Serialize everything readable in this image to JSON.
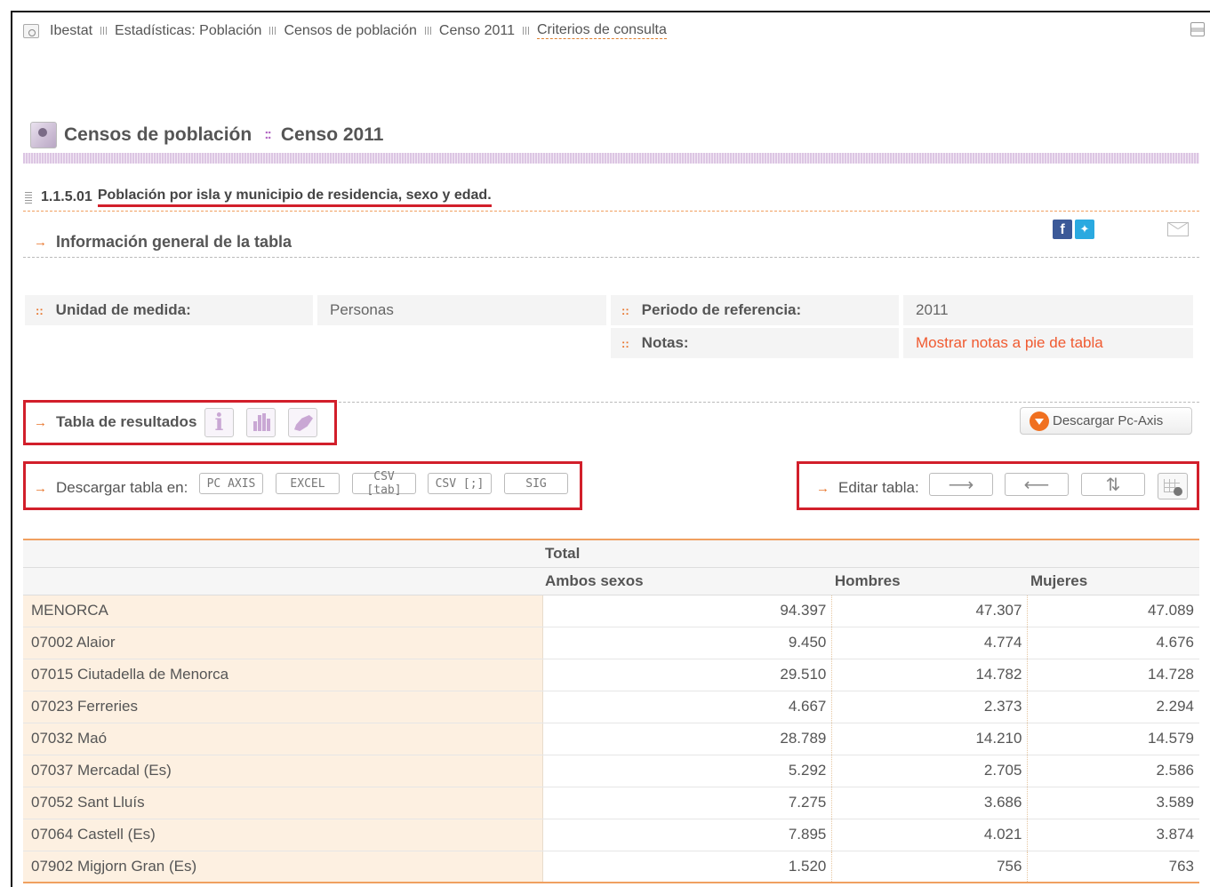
{
  "breadcrumb": {
    "items": [
      "Ibestat",
      "Estadísticas: Población",
      "Censos de población",
      "Censo 2011",
      "Criterios de consulta"
    ]
  },
  "section": {
    "title": "Censos de población",
    "subtitle": "Censo 2011",
    "separator": "::"
  },
  "table_header": {
    "code": "1.1.5.01",
    "name": "Población por isla y municipio de residencia, sexo y edad."
  },
  "info": {
    "heading": "Información general de la tabla",
    "unit_label": "Unidad de medida:",
    "unit_value": "Personas",
    "period_label": "Periodo de referencia:",
    "period_value": "2011",
    "notes_label": "Notas:",
    "notes_value": "Mostrar notas a pie de tabla"
  },
  "results": {
    "heading": "Tabla de resultados",
    "pcaxis_button": "Descargar Pc-Axis"
  },
  "download": {
    "label": "Descargar tabla en:",
    "formats": [
      "PC AXIS",
      "EXCEL",
      "CSV [tab]",
      "CSV [;]",
      "SIG"
    ]
  },
  "edit": {
    "label": "Editar tabla:",
    "buttons": [
      "⟶",
      "⟵",
      "⇅"
    ]
  },
  "table": {
    "group_header": "Total",
    "columns": [
      "Ambos sexos",
      "Hombres",
      "Mujeres"
    ],
    "rows": [
      {
        "name": "MENORCA",
        "values": [
          "94.397",
          "47.307",
          "47.089"
        ]
      },
      {
        "name": "07002 Alaior",
        "values": [
          "9.450",
          "4.774",
          "4.676"
        ]
      },
      {
        "name": "07015 Ciutadella de Menorca",
        "values": [
          "29.510",
          "14.782",
          "14.728"
        ]
      },
      {
        "name": "07023 Ferreries",
        "values": [
          "4.667",
          "2.373",
          "2.294"
        ]
      },
      {
        "name": "07032 Maó",
        "values": [
          "28.789",
          "14.210",
          "14.579"
        ]
      },
      {
        "name": "07037 Mercadal (Es)",
        "values": [
          "5.292",
          "2.705",
          "2.586"
        ]
      },
      {
        "name": "07052 Sant Lluís",
        "values": [
          "7.275",
          "3.686",
          "3.589"
        ]
      },
      {
        "name": "07064 Castell (Es)",
        "values": [
          "7.895",
          "4.021",
          "3.874"
        ]
      },
      {
        "name": "07902 Migjorn Gran (Es)",
        "values": [
          "1.520",
          "756",
          "763"
        ]
      }
    ]
  },
  "colors": {
    "accent": "#e8742a",
    "highlight_red": "#d21f2b",
    "link": "#f05a30",
    "section_purple": "#b46ac4"
  }
}
